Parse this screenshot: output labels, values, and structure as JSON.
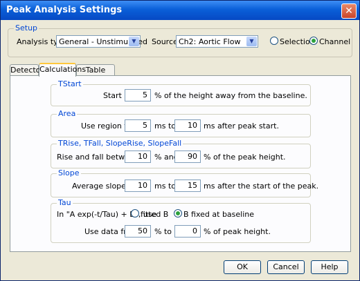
{
  "window": {
    "title": "Peak Analysis Settings",
    "close_glyph": "✕"
  },
  "setup": {
    "legend": "Setup",
    "analysis_type_label": "Analysis type:",
    "analysis_type_value": "General - Unstimulated",
    "source_label": "Source:",
    "source_value": "Ch2: Aortic Flow",
    "radio_selection": "Selection",
    "radio_channel": "Channel",
    "selected_radio": "Channel"
  },
  "tabs": [
    "Detector",
    "Calculations",
    "Table Options"
  ],
  "active_tab": "Calculations",
  "calc": {
    "tstart": {
      "legend": "TStart",
      "pre": "Start is",
      "value": "5",
      "post": "% of the height away from the baseline."
    },
    "area": {
      "legend": "Area",
      "pre": "Use region from",
      "v1": "5",
      "mid": "ms to",
      "v2": "10",
      "post": "ms after peak start."
    },
    "trise": {
      "legend": "TRise, TFall, SlopeRise, SlopeFall",
      "pre": "Rise and fall between",
      "v1": "10",
      "mid": "% and",
      "v2": "90",
      "post": "% of the peak height."
    },
    "slope": {
      "legend": "Slope",
      "pre": "Average slope from",
      "v1": "10",
      "mid": "ms to",
      "v2": "15",
      "post": "ms after the start of the peak."
    },
    "tau": {
      "legend": "Tau",
      "formula": "In  \"A exp(-t/Tau) + B\", use",
      "opt1": "fitted B",
      "opt2": "B fixed at baseline",
      "selected": "B fixed at baseline",
      "pre": "Use data from",
      "v1": "50",
      "mid": "% to",
      "v2": "0",
      "post": "% of peak height."
    }
  },
  "buttons": {
    "ok": "OK",
    "cancel": "Cancel",
    "help": "Help"
  }
}
